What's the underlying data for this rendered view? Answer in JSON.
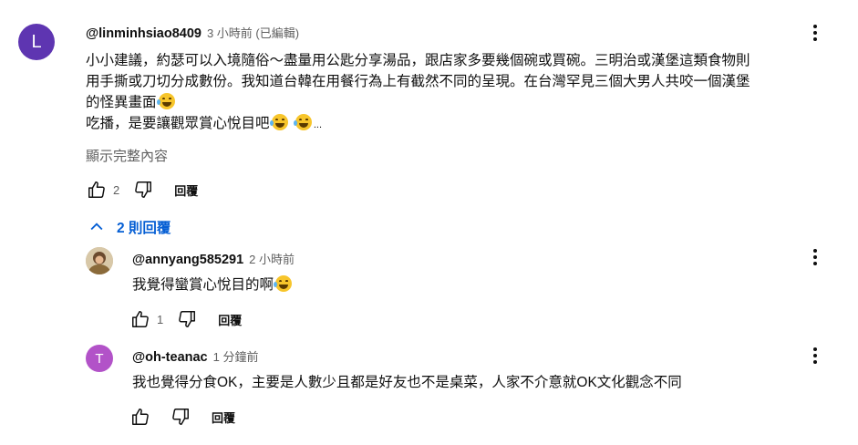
{
  "main_comment": {
    "avatar_letter": "L",
    "author": "@linminhsiao8409",
    "time": "3 小時前 (已編輯)",
    "lines": [
      "小小建議，約瑟可以入境隨俗～盡量用公匙分享湯品，跟店家多要幾個碗或買碗。三明治或漢堡這類食物則",
      "用手撕或刀切分成數份。我知道台韓在用餐行為上有截然不同的呈現。在台灣罕見三個大男人共咬一個漢堡",
      "的怪異畫面",
      "吃播，是要讓觀眾賞心悅目吧"
    ],
    "ellipsis": "...",
    "show_more": "顯示完整內容",
    "likes": "2",
    "reply_label": "回覆"
  },
  "replies_toggle": {
    "label": "2 則回覆"
  },
  "replies": [
    {
      "author": "@annyang585291",
      "time": "2 小時前",
      "text": "我覺得蠻賞心悅目的啊",
      "likes": "1",
      "reply_label": "回覆"
    },
    {
      "avatar_letter": "T",
      "author": "@oh-teanac",
      "time": "1 分鐘前",
      "text": "我也覺得分食OK，主要是人數少且都是好友也不是桌菜，人家不介意就OK文化觀念不同",
      "likes": "",
      "reply_label": "回覆"
    }
  ],
  "colors": {
    "link_blue": "#065fd4",
    "avatar_purple": "#5e35b1",
    "avatar_pink": "#b252c8"
  },
  "icons": [
    "thumb-up-icon",
    "thumb-down-icon",
    "more-vert-icon",
    "chevron-up-icon",
    "laughing-emoji-icon"
  ]
}
